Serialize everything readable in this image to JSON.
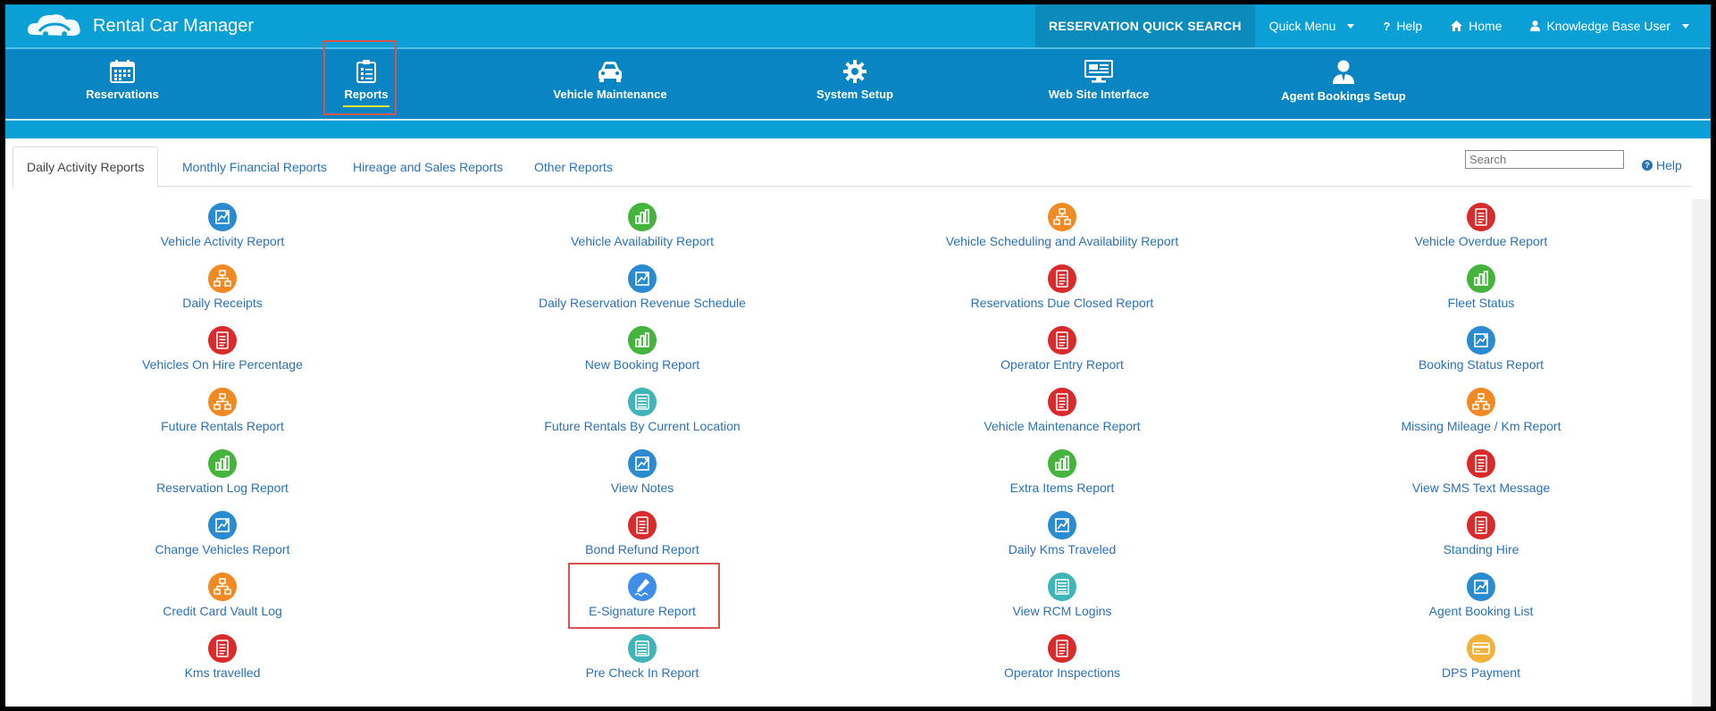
{
  "app": {
    "title": "Rental Car Manager"
  },
  "topnav": {
    "quick_search": "RESERVATION QUICK SEARCH",
    "quick_menu": "Quick Menu",
    "help": "Help",
    "home": "Home",
    "user": "Knowledge Base User"
  },
  "mainnav": {
    "items": [
      {
        "label": "Reservations",
        "icon": "calendar-icon"
      },
      {
        "label": "Reports",
        "icon": "clipboard-icon"
      },
      {
        "label": "Vehicle Maintenance",
        "icon": "car-icon"
      },
      {
        "label": "System Setup",
        "icon": "gear-icon"
      },
      {
        "label": "Web Site Interface",
        "icon": "monitor-icon"
      },
      {
        "label": "Agent Bookings Setup",
        "icon": "agent-icon"
      }
    ],
    "active": "Reports"
  },
  "tabs": [
    {
      "label": "Daily Activity Reports",
      "active": true
    },
    {
      "label": "Monthly Financial Reports",
      "active": false
    },
    {
      "label": "Hireage and Sales Reports",
      "active": false
    },
    {
      "label": "Other Reports",
      "active": false
    }
  ],
  "search": {
    "placeholder": "Search",
    "value": ""
  },
  "help_link": "Help",
  "colors": {
    "blue": "#2a8bd0",
    "green": "#45b43c",
    "orange": "#f28a24",
    "red": "#d92b2b",
    "teal": "#40b5b7",
    "lightblue": "#3f8fe8",
    "gold": "#f0b23a"
  },
  "reports": {
    "columns": [
      [
        {
          "label": "Vehicle Activity Report",
          "color": "blue",
          "icon": "chart-icon"
        },
        {
          "label": "Daily Receipts",
          "color": "orange",
          "icon": "sitemap-icon"
        },
        {
          "label": "Vehicles On Hire Percentage",
          "color": "red",
          "icon": "document-icon"
        },
        {
          "label": "Future Rentals Report",
          "color": "orange",
          "icon": "sitemap-icon"
        },
        {
          "label": "Reservation Log Report",
          "color": "green",
          "icon": "bar-chart-icon"
        },
        {
          "label": "Change Vehicles Report",
          "color": "blue",
          "icon": "chart-icon"
        },
        {
          "label": "Credit Card Vault Log",
          "color": "orange",
          "icon": "sitemap-icon"
        },
        {
          "label": "Kms travelled",
          "color": "red",
          "icon": "document-icon"
        }
      ],
      [
        {
          "label": "Vehicle Availability Report",
          "color": "green",
          "icon": "bar-chart-icon"
        },
        {
          "label": "Daily Reservation Revenue Schedule",
          "color": "blue",
          "icon": "chart-icon"
        },
        {
          "label": "New Booking Report",
          "color": "green",
          "icon": "bar-chart-icon"
        },
        {
          "label": "Future Rentals By Current Location",
          "color": "teal",
          "icon": "list-icon"
        },
        {
          "label": "View Notes",
          "color": "blue",
          "icon": "chart-icon"
        },
        {
          "label": "Bond Refund Report",
          "color": "red",
          "icon": "document-icon"
        },
        {
          "label": "E-Signature Report",
          "color": "lightblue",
          "icon": "signature-icon"
        },
        {
          "label": "Pre Check In Report",
          "color": "teal",
          "icon": "list-icon"
        }
      ],
      [
        {
          "label": "Vehicle Scheduling and Availability Report",
          "color": "orange",
          "icon": "sitemap-icon"
        },
        {
          "label": "Reservations Due Closed Report",
          "color": "red",
          "icon": "document-icon"
        },
        {
          "label": "Operator Entry Report",
          "color": "red",
          "icon": "document-icon"
        },
        {
          "label": "Vehicle Maintenance Report",
          "color": "red",
          "icon": "document-icon"
        },
        {
          "label": "Extra Items Report",
          "color": "green",
          "icon": "bar-chart-icon"
        },
        {
          "label": "Daily Kms Traveled",
          "color": "blue",
          "icon": "chart-icon"
        },
        {
          "label": "View RCM Logins",
          "color": "teal",
          "icon": "list-icon"
        },
        {
          "label": "Operator Inspections",
          "color": "red",
          "icon": "document-icon"
        }
      ],
      [
        {
          "label": "Vehicle Overdue Report",
          "color": "red",
          "icon": "document-icon"
        },
        {
          "label": "Fleet Status",
          "color": "green",
          "icon": "bar-chart-icon"
        },
        {
          "label": "Booking Status Report",
          "color": "blue",
          "icon": "chart-icon"
        },
        {
          "label": "Missing Mileage / Km Report",
          "color": "orange",
          "icon": "sitemap-icon"
        },
        {
          "label": "View SMS Text Message",
          "color": "red",
          "icon": "document-icon"
        },
        {
          "label": "Standing Hire",
          "color": "red",
          "icon": "document-icon"
        },
        {
          "label": "Agent Booking List",
          "color": "blue",
          "icon": "chart-icon"
        },
        {
          "label": "DPS Payment",
          "color": "gold",
          "icon": "card-icon"
        }
      ]
    ]
  }
}
